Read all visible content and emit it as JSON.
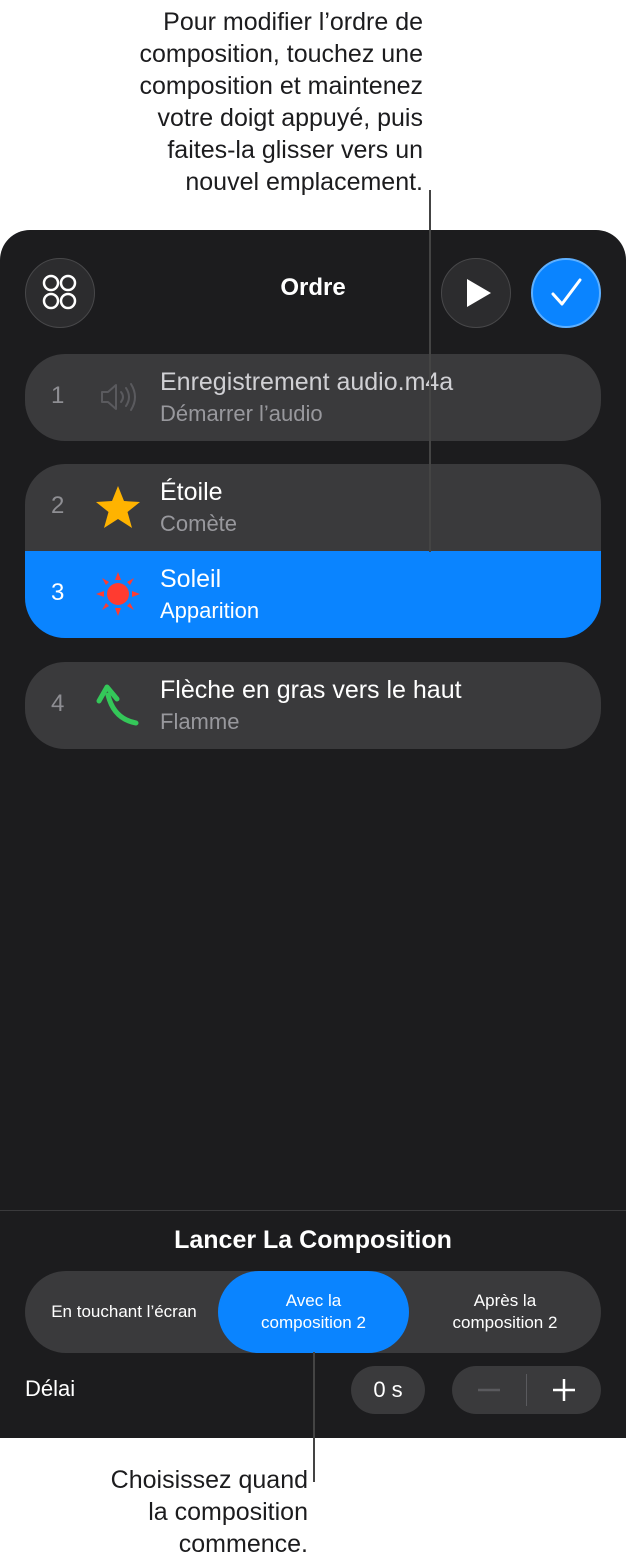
{
  "callouts": {
    "top": [
      "Pour modifier l’ordre de",
      "composition, touchez une",
      "composition et maintenez",
      "votre doigt appuyé, puis",
      "faites-la glisser vers un",
      "nouvel emplacement."
    ],
    "bottom": [
      "Choisissez quand",
      "la composition",
      "commence."
    ]
  },
  "header": {
    "title": "Ordre",
    "icons": {
      "layers": "layers-icon",
      "play": "play-icon",
      "done": "checkmark-icon"
    }
  },
  "builds": [
    {
      "number": "1",
      "title": "Enregistrement audio.m4a",
      "subtitle": "Démarrer l’audio",
      "icon": "speaker-icon"
    },
    {
      "number": "2",
      "title": "Étoile",
      "subtitle": "Comète",
      "icon": "star-icon"
    },
    {
      "number": "3",
      "title": "Soleil",
      "subtitle": "Apparition",
      "icon": "sun-icon",
      "selected": true
    },
    {
      "number": "4",
      "title": "Flèche en gras vers le haut",
      "subtitle": "Flamme",
      "icon": "curved-arrow-icon"
    }
  ],
  "start": {
    "title": "Lancer La Composition",
    "options": [
      {
        "label": "En touchant l’écran"
      },
      {
        "label_line1": "Avec la",
        "label_line2": "composition 2",
        "active": true
      },
      {
        "label_line1": "Après la",
        "label_line2": "composition 2"
      }
    ],
    "selected_index": 1
  },
  "delay": {
    "label": "Délai",
    "value": "0 s"
  },
  "colors": {
    "accent": "#0a84ff",
    "panel": "#1c1c1e",
    "row": "#3a3a3c",
    "star": "#ffb300",
    "sun": "#ff3b30",
    "arrow": "#34c759"
  }
}
